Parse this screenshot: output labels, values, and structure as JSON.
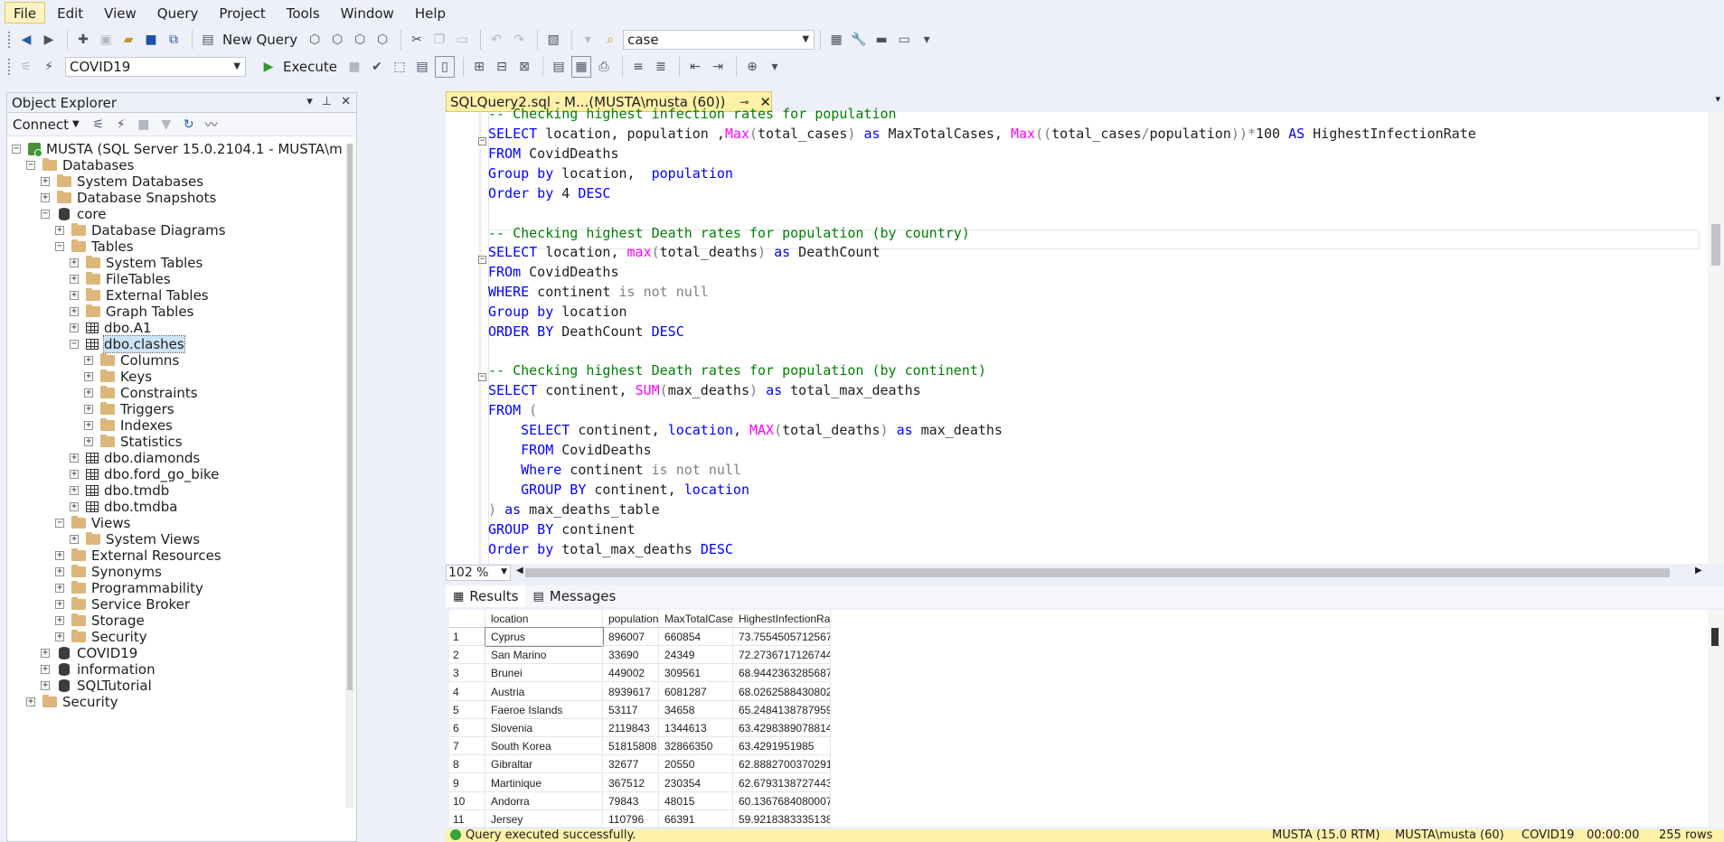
{
  "menu": [
    "File",
    "Edit",
    "View",
    "Query",
    "Project",
    "Tools",
    "Window",
    "Help"
  ],
  "toolbar1": {
    "new_query": "New Query",
    "search_value": "case"
  },
  "toolbar2": {
    "database": "COVID19",
    "execute": "Execute"
  },
  "object_explorer": {
    "title": "Object Explorer",
    "connect": "Connect",
    "server": "MUSTA (SQL Server 15.0.2104.1 - MUSTA\\musta)",
    "nodes": [
      "Databases",
      "System Databases",
      "Database Snapshots",
      "core",
      "Database Diagrams",
      "Tables",
      "System Tables",
      "FileTables",
      "External Tables",
      "Graph Tables",
      "dbo.A1",
      "dbo.clashes",
      "Columns",
      "Keys",
      "Constraints",
      "Triggers",
      "Indexes",
      "Statistics",
      "dbo.diamonds",
      "dbo.ford_go_bike",
      "dbo.tmdb",
      "dbo.tmdba",
      "Views",
      "System Views",
      "External Resources",
      "Synonyms",
      "Programmability",
      "Service Broker",
      "Storage",
      "Security",
      "COVID19",
      "information",
      "SQLTutorial",
      "Security"
    ]
  },
  "editor": {
    "tab": "SQLQuery2.sql - M...(MUSTA\\musta (60))",
    "zoom": "102 %",
    "lines": [
      "-- Checking highest infection rates for population",
      "SELECT location, population ,Max(total_cases) as MaxTotalCases, Max((total_cases/population))*100 AS HighestInfectionRate",
      "FROM CovidDeaths",
      "Group by location,  population",
      "Order by 4 DESC",
      "",
      "-- Checking highest Death rates for population (by country)",
      "SELECT location, max(total_deaths) as DeathCount",
      "FROm CovidDeaths",
      "WHERE continent is not null",
      "Group by location",
      "ORDER BY DeathCount DESC",
      "",
      "-- Checking highest Death rates for population (by continent)",
      "SELECT continent, SUM(max_deaths) as total_max_deaths",
      "FROM (",
      "    SELECT continent, location, MAX(total_deaths) as max_deaths",
      "    FROM CovidDeaths",
      "    Where continent is not null",
      "    GROUP BY continent, location",
      ") as max_deaths_table",
      "GROUP BY continent",
      "Order by total_max_deaths DESC"
    ]
  },
  "results": {
    "tab_results": "Results",
    "tab_messages": "Messages",
    "columns": [
      "location",
      "population",
      "MaxTotalCases",
      "HighestInfectionRate"
    ],
    "rows": [
      [
        "1",
        "Cyprus",
        "896007",
        "660854",
        "73.7554505712567"
      ],
      [
        "2",
        "San Marino",
        "33690",
        "24349",
        "72.2736717126744"
      ],
      [
        "3",
        "Brunei",
        "449002",
        "309561",
        "68.9442363285687"
      ],
      [
        "4",
        "Austria",
        "8939617",
        "6081287",
        "68.0262588430802"
      ],
      [
        "5",
        "Faeroe Islands",
        "53117",
        "34658",
        "65.2484138787959"
      ],
      [
        "6",
        "Slovenia",
        "2119843",
        "1344613",
        "63.4298389078814"
      ],
      [
        "7",
        "South Korea",
        "51815808",
        "32866350",
        "63.4291951985"
      ],
      [
        "8",
        "Gibraltar",
        "32677",
        "20550",
        "62.8882700370291"
      ],
      [
        "9",
        "Martinique",
        "367512",
        "230354",
        "62.6793138727443"
      ],
      [
        "10",
        "Andorra",
        "79843",
        "48015",
        "60.1367684080007"
      ],
      [
        "11",
        "Jersey",
        "110796",
        "66391",
        "59.9218383335138"
      ]
    ]
  },
  "status": {
    "message": "Query executed successfully.",
    "server": "MUSTA (15.0 RTM)",
    "user": "MUSTA\\musta (60)",
    "db": "COVID19",
    "time": "00:00:00",
    "rows": "255 rows"
  }
}
